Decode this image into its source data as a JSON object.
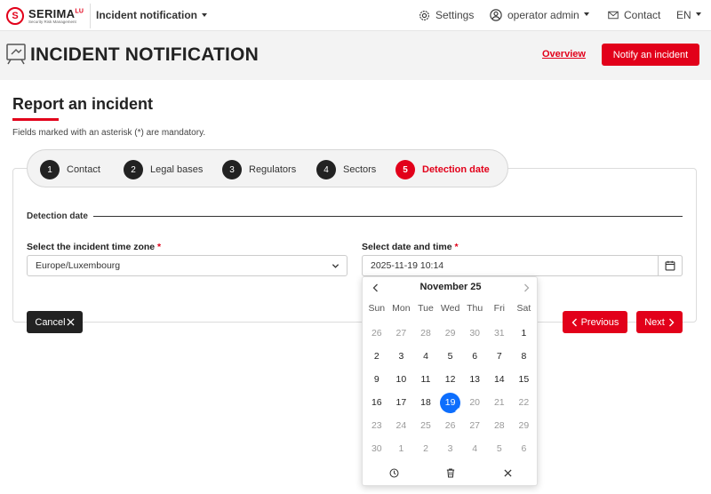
{
  "navbar": {
    "logo_name": "SERIMA",
    "logo_suffix": "LU",
    "logo_tagline": "Security Risk Management",
    "app_menu": "Incident notification",
    "settings": "Settings",
    "user": "operator admin",
    "contact": "Contact",
    "language": "EN"
  },
  "header": {
    "title": "INCIDENT NOTIFICATION",
    "overview_link": "Overview",
    "notify_button": "Notify an incident"
  },
  "section": {
    "title": "Report an incident",
    "mandatory_note": "Fields marked with an asterisk (*) are mandatory."
  },
  "steps": [
    {
      "num": "1",
      "label": "Contact",
      "active": false
    },
    {
      "num": "2",
      "label": "Legal bases",
      "active": false
    },
    {
      "num": "3",
      "label": "Regulators",
      "active": false
    },
    {
      "num": "4",
      "label": "Sectors",
      "active": false
    },
    {
      "num": "5",
      "label": "Detection date",
      "active": true
    }
  ],
  "form": {
    "legend": "Detection date",
    "timezone_label": "Select the incident time zone",
    "timezone_value": "Europe/Luxembourg",
    "datetime_label": "Select date and time",
    "datetime_value": "2025-11-19 10:14",
    "asterisk": "*"
  },
  "buttons": {
    "cancel": "Cancel",
    "previous": "Previous",
    "next": "Next"
  },
  "datepicker": {
    "month": "November 25",
    "weekdays": [
      "Sun",
      "Mon",
      "Tue",
      "Wed",
      "Thu",
      "Fri",
      "Sat"
    ],
    "weeks": [
      [
        "26",
        "27",
        "28",
        "29",
        "30",
        "31",
        "1"
      ],
      [
        "2",
        "3",
        "4",
        "5",
        "6",
        "7",
        "8"
      ],
      [
        "9",
        "10",
        "11",
        "12",
        "13",
        "14",
        "15"
      ],
      [
        "16",
        "17",
        "18",
        "19",
        "20",
        "21",
        "22"
      ],
      [
        "23",
        "24",
        "25",
        "26",
        "27",
        "28",
        "29"
      ],
      [
        "30",
        "1",
        "2",
        "3",
        "4",
        "5",
        "6"
      ]
    ],
    "selected": "19"
  },
  "colors": {
    "brand_red": "#e2001a",
    "selected_blue": "#0d6efd",
    "dark": "#222222"
  }
}
